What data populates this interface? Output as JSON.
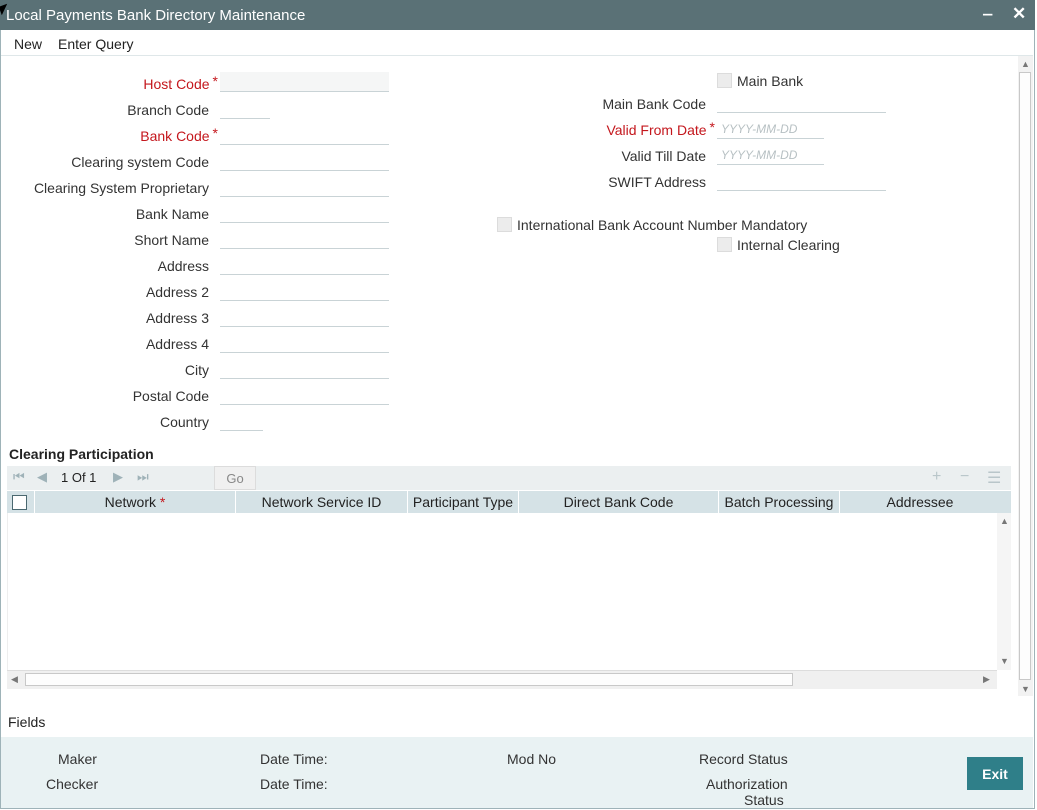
{
  "window": {
    "title": "Local Payments Bank Directory Maintenance",
    "minimize_glyph": "‒",
    "close_glyph": "✕"
  },
  "menu": {
    "new": "New",
    "enter_query": "Enter Query"
  },
  "form": {
    "host_code": {
      "label": "Host Code",
      "value": ""
    },
    "branch_code": {
      "label": "Branch Code",
      "value": ""
    },
    "bank_code": {
      "label": "Bank Code",
      "value": ""
    },
    "clearing_system_code": {
      "label": "Clearing system Code",
      "value": ""
    },
    "clearing_system_proprietary": {
      "label": "Clearing System Proprietary",
      "value": ""
    },
    "bank_name": {
      "label": "Bank Name",
      "value": ""
    },
    "short_name": {
      "label": "Short Name",
      "value": ""
    },
    "address": {
      "label": "Address",
      "value": ""
    },
    "address2": {
      "label": "Address 2",
      "value": ""
    },
    "address3": {
      "label": "Address 3",
      "value": ""
    },
    "address4": {
      "label": "Address 4",
      "value": ""
    },
    "city": {
      "label": "City",
      "value": ""
    },
    "postal_code": {
      "label": "Postal Code",
      "value": ""
    },
    "country": {
      "label": "Country",
      "value": ""
    },
    "main_bank": {
      "label": "Main Bank",
      "checked": false
    },
    "main_bank_code": {
      "label": "Main Bank Code",
      "value": ""
    },
    "valid_from_date": {
      "label": "Valid From Date",
      "placeholder": "YYYY-MM-DD"
    },
    "valid_till_date": {
      "label": "Valid Till Date",
      "placeholder": "YYYY-MM-DD"
    },
    "swift_address": {
      "label": "SWIFT Address",
      "value": ""
    },
    "iban_mandatory": {
      "label": "International Bank Account Number Mandatory",
      "checked": false
    },
    "internal_clearing": {
      "label": "Internal Clearing",
      "checked": false
    },
    "required_mark": "*"
  },
  "clearing_participation": {
    "title": "Clearing Participation",
    "pagination": "1 Of 1",
    "go_label": "Go",
    "columns": [
      "Network",
      "Network Service ID",
      "Participant Type",
      "Direct Bank Code",
      "Batch Processing",
      "Addressee"
    ],
    "rows": []
  },
  "fields_label": "Fields",
  "footer": {
    "maker": "Maker",
    "checker": "Checker",
    "date_time_1": "Date Time:",
    "date_time_2": "Date Time:",
    "mod_no": "Mod No",
    "record_status": "Record Status",
    "authorization_status_1": "Authorization",
    "authorization_status_2": "Status"
  },
  "exit_label": "Exit",
  "colors": {
    "titlebar": "#5a7176",
    "required": "#c4171d",
    "grid_header": "#d5e2e6",
    "footer": "#e9f2f3",
    "exit_button": "#2f7f89"
  }
}
